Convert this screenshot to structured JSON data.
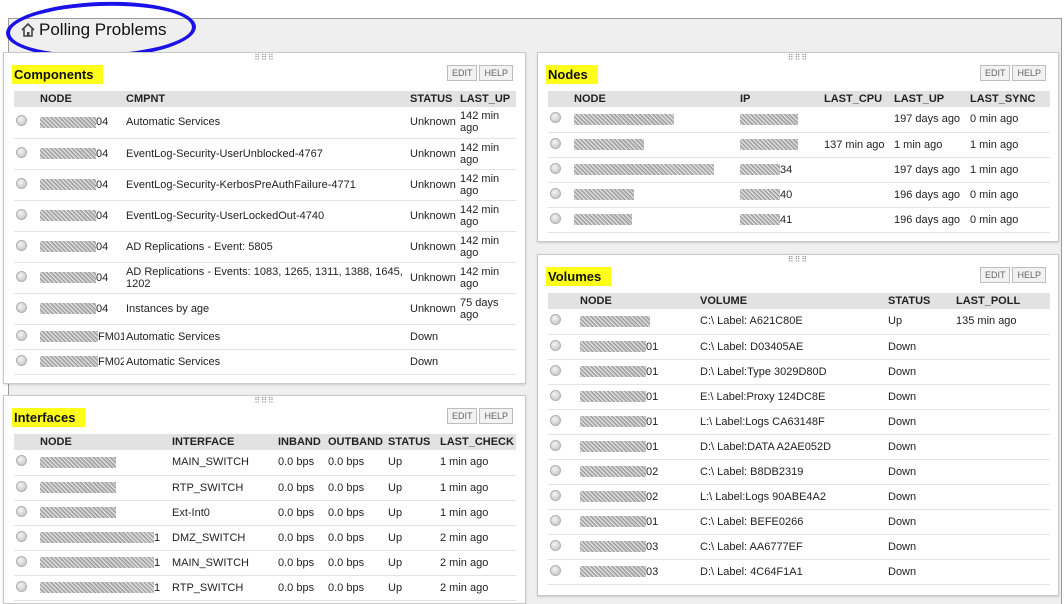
{
  "page": {
    "title": "Polling Problems"
  },
  "panels": {
    "components": {
      "title": "Components",
      "edit": "EDIT",
      "help": "HELP",
      "columns": [
        "NODE",
        "CMPNT",
        "STATUS",
        "LAST_UP"
      ],
      "rows": [
        {
          "node_suffix": "04",
          "cmpnt": "Automatic Services",
          "status": "Unknown",
          "last_up": "142 min ago"
        },
        {
          "node_suffix": "04",
          "cmpnt": "EventLog-Security-UserUnblocked-4767",
          "status": "Unknown",
          "last_up": "142 min ago"
        },
        {
          "node_suffix": "04",
          "cmpnt": "EventLog-Security-KerbosPreAuthFailure-4771",
          "status": "Unknown",
          "last_up": "142 min ago"
        },
        {
          "node_suffix": "04",
          "cmpnt": "EventLog-Security-UserLockedOut-4740",
          "status": "Unknown",
          "last_up": "142 min ago"
        },
        {
          "node_suffix": "04",
          "cmpnt": "AD Replications - Event: 5805",
          "status": "Unknown",
          "last_up": "142 min ago"
        },
        {
          "node_suffix": "04",
          "cmpnt": "AD Replications - Events: 1083, 1265, 1311, 1388, 1645, 1202",
          "status": "Unknown",
          "last_up": "142 min ago"
        },
        {
          "node_suffix": "04",
          "cmpnt": "Instances by age",
          "status": "Unknown",
          "last_up": "75 days ago"
        },
        {
          "node_suffix": "FM01",
          "cmpnt": "Automatic Services",
          "status": "Down",
          "last_up": ""
        },
        {
          "node_suffix": "FM02",
          "cmpnt": "Automatic Services",
          "status": "Down",
          "last_up": ""
        }
      ]
    },
    "interfaces": {
      "title": "Interfaces",
      "edit": "EDIT",
      "help": "HELP",
      "columns": [
        "NODE",
        "INTERFACE",
        "INBAND",
        "OUTBAND",
        "STATUS",
        "LAST_CHECK"
      ],
      "rows": [
        {
          "node_suffix": "",
          "interface": "MAIN_SWITCH",
          "inband": "0.0 bps",
          "outband": "0.0 bps",
          "status": "Up",
          "last_check": "1 min ago"
        },
        {
          "node_suffix": "",
          "interface": "RTP_SWITCH",
          "inband": "0.0 bps",
          "outband": "0.0 bps",
          "status": "Up",
          "last_check": "1 min ago"
        },
        {
          "node_suffix": "",
          "interface": "Ext-Int0",
          "inband": "0.0 bps",
          "outband": "0.0 bps",
          "status": "Up",
          "last_check": "1 min ago"
        },
        {
          "node_suffix": "1",
          "interface": "DMZ_SWITCH",
          "inband": "0.0 bps",
          "outband": "0.0 bps",
          "status": "Up",
          "last_check": "2 min ago"
        },
        {
          "node_suffix": "1",
          "interface": "MAIN_SWITCH",
          "inband": "0.0 bps",
          "outband": "0.0 bps",
          "status": "Up",
          "last_check": "2 min ago"
        },
        {
          "node_suffix": "1",
          "interface": "RTP_SWITCH",
          "inband": "0.0 bps",
          "outband": "0.0 bps",
          "status": "Up",
          "last_check": "2 min ago"
        }
      ]
    },
    "nodes": {
      "title": "Nodes",
      "edit": "EDIT",
      "help": "HELP",
      "columns": [
        "NODE",
        "IP",
        "LAST_CPU",
        "LAST_UP",
        "LAST_SYNC"
      ],
      "rows": [
        {
          "ip_suffix": "",
          "last_cpu": "",
          "last_up": "197 days ago",
          "last_sync": "0 min ago"
        },
        {
          "ip_suffix": "",
          "last_cpu": "137 min ago",
          "last_up": "1 min ago",
          "last_sync": "1 min ago"
        },
        {
          "ip_suffix": "34",
          "last_cpu": "",
          "last_up": "197 days ago",
          "last_sync": "1 min ago"
        },
        {
          "ip_suffix": "40",
          "last_cpu": "",
          "last_up": "196 days ago",
          "last_sync": "0 min ago"
        },
        {
          "ip_suffix": "41",
          "last_cpu": "",
          "last_up": "196 days ago",
          "last_sync": "0 min ago"
        }
      ]
    },
    "volumes": {
      "title": "Volumes",
      "edit": "EDIT",
      "help": "HELP",
      "columns": [
        "NODE",
        "VOLUME",
        "STATUS",
        "LAST_POLL"
      ],
      "rows": [
        {
          "node_suffix": "",
          "volume": "C:\\ Label: A621C80E",
          "status": "Up",
          "last_poll": "135 min ago"
        },
        {
          "node_suffix": "01",
          "volume": "C:\\ Label: D03405AE",
          "status": "Down",
          "last_poll": ""
        },
        {
          "node_suffix": "01",
          "volume": "D:\\ Label:Type 3029D80D",
          "status": "Down",
          "last_poll": ""
        },
        {
          "node_suffix": "01",
          "volume": "E:\\ Label:Proxy 124DC8E",
          "status": "Down",
          "last_poll": ""
        },
        {
          "node_suffix": "01",
          "volume": "L:\\ Label:Logs CA63148F",
          "status": "Down",
          "last_poll": ""
        },
        {
          "node_suffix": "01",
          "volume": "D:\\ Label:DATA A2AE052D",
          "status": "Down",
          "last_poll": ""
        },
        {
          "node_suffix": "02",
          "volume": "C:\\ Label: B8DB2319",
          "status": "Down",
          "last_poll": ""
        },
        {
          "node_suffix": "02",
          "volume": "L:\\ Label:Logs 90ABE4A2",
          "status": "Down",
          "last_poll": ""
        },
        {
          "node_suffix": "01",
          "volume": "C:\\ Label: BEFE0266",
          "status": "Down",
          "last_poll": ""
        },
        {
          "node_suffix": "03",
          "volume": "C:\\ Label: AA6777EF",
          "status": "Down",
          "last_poll": ""
        },
        {
          "node_suffix": "03",
          "volume": "D:\\ Label: 4C64F1A1",
          "status": "Down",
          "last_poll": ""
        }
      ]
    }
  },
  "colors": {
    "highlight": "#ffff1a",
    "annotation_ring": "#1a10e8",
    "header_bg": "#e2e2e2"
  }
}
